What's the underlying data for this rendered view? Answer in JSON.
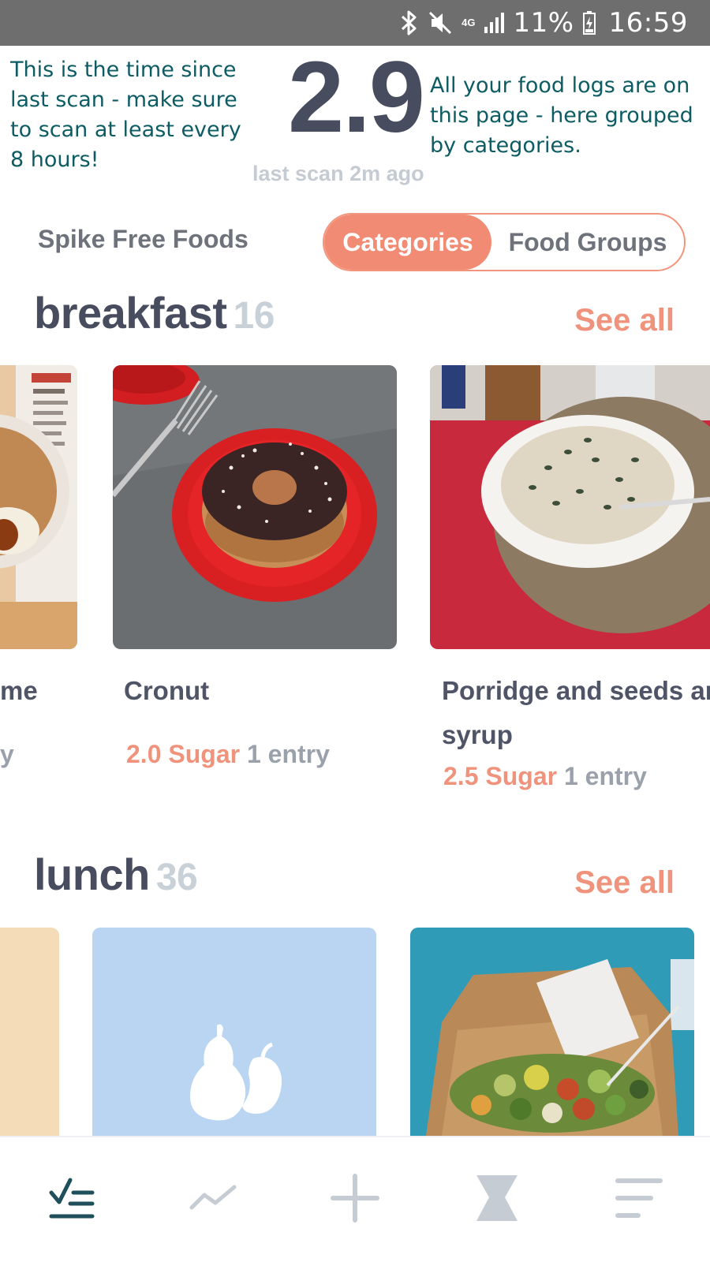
{
  "status_bar": {
    "network": "4G",
    "battery": "11%",
    "time": "16:59"
  },
  "header": {
    "tip_left": "This is the time since last scan - make sure to scan at least every 8 hours!",
    "value": "2.9",
    "last_scan": "last scan 2m ago",
    "tip_right": "All your food logs are on this page - here grouped by categories."
  },
  "tabs": {
    "spike_free": "Spike Free Foods",
    "categories": "Categories",
    "food_groups": "Food Groups",
    "selected": "Categories"
  },
  "sections": {
    "breakfast": {
      "title": "breakfast",
      "count": "16",
      "see_all": "See all",
      "partial_name": "me",
      "partial_meta": "y",
      "items": [
        {
          "name": "Cronut",
          "sugar": "2.0 Sugar",
          "entries": "1 entry"
        },
        {
          "name": "Porridge and seeds ar",
          "name_line2": "syrup",
          "sugar": "2.5 Sugar",
          "entries": "1 entry"
        }
      ]
    },
    "lunch": {
      "title": "lunch",
      "count": "36",
      "see_all": "See all"
    }
  },
  "colors": {
    "accent": "#f28b73",
    "title": "#474d5f",
    "tip": "#0d5c63",
    "nav_active": "#1f4f5a",
    "nav_inactive": "#c6ccd3"
  },
  "icons": {
    "status": [
      "bluetooth-icon",
      "mute-icon",
      "signal-icon",
      "battery-charging-icon"
    ],
    "nav": [
      "food-log-icon",
      "trend-icon",
      "add-icon",
      "hourglass-icon",
      "menu-icon"
    ],
    "placeholder": "pear-apple-icon"
  }
}
